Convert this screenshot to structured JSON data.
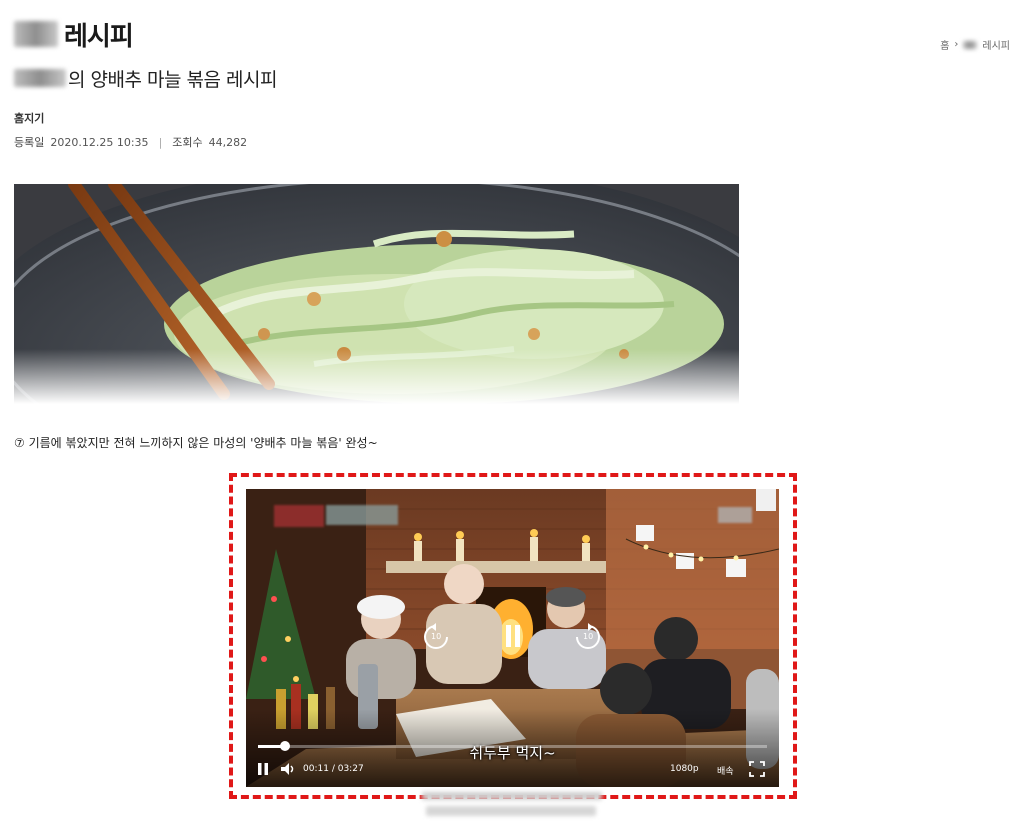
{
  "header": {
    "title": "레시피",
    "breadcrumb": {
      "home": "홈",
      "separator": "›",
      "current": "레시피"
    }
  },
  "recipe": {
    "title": "의 양배추 마늘 볶음 레시피",
    "author": "홈지기",
    "registered_label": "등록일",
    "registered_value": "2020.12.25 10:35",
    "separator": "|",
    "views_label": "조회수",
    "views_value": "44,282"
  },
  "step": {
    "text": "⑦ 기름에 볶았지만 전혀 느끼하지 않은 마성의 '양배추 마늘 볶음' 완성~"
  },
  "video": {
    "caption": "쉬두부 먹지~",
    "current_time": "00:11",
    "time_separator": "/",
    "duration": "03:27",
    "progress": 0.053,
    "quality": "1080p",
    "speed_label": "배속",
    "rewind_seconds": "10",
    "forward_seconds": "10",
    "icons": {
      "play_pause": "pause-icon",
      "volume": "volume-icon",
      "fullscreen": "fullscreen-icon",
      "rewind": "rewind-10-icon",
      "forward": "forward-10-icon"
    },
    "colors": {
      "highlight_border": "#e01818",
      "progress_played": "#ffffff"
    }
  }
}
